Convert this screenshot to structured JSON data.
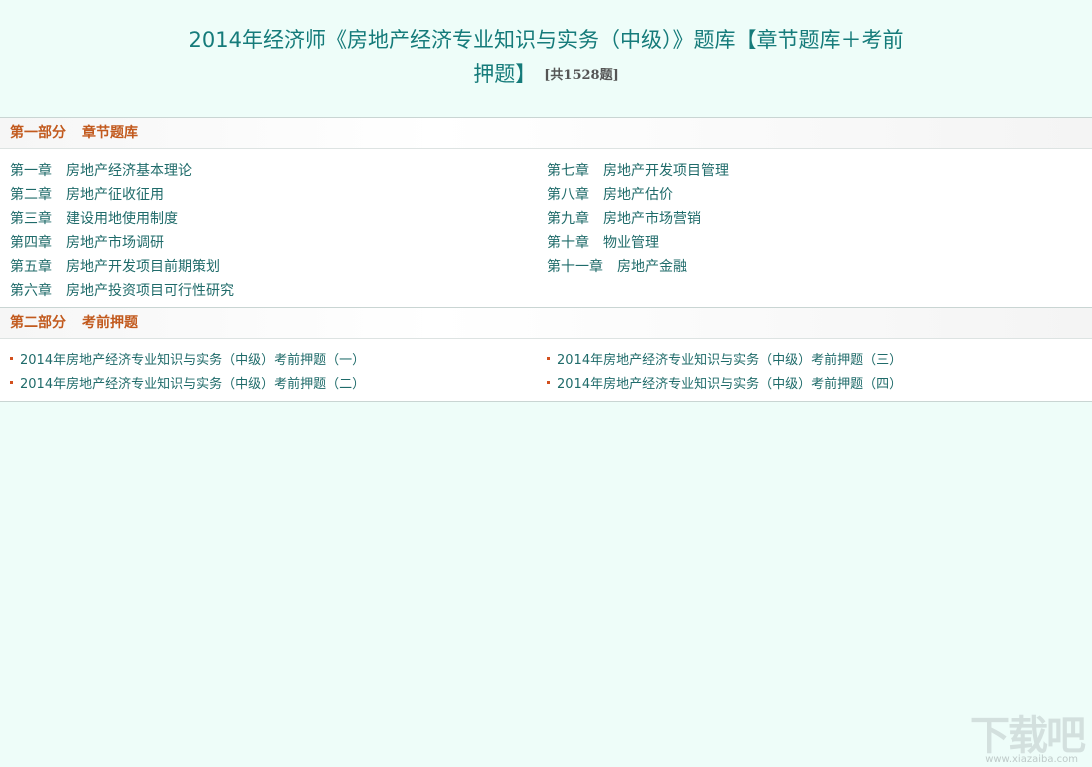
{
  "header": {
    "title_line1": "2014年经济师《房地产经济专业知识与实务（中级）》题库【章节题库＋考前",
    "title_line2": "押题】",
    "count": "[共1528题]"
  },
  "part1": {
    "part": "第一部分",
    "name": "章节题库",
    "chapters": [
      {
        "num": "第一章",
        "title": "房地产经济基本理论"
      },
      {
        "num": "第七章",
        "title": "房地产开发项目管理"
      },
      {
        "num": "第二章",
        "title": "房地产征收征用"
      },
      {
        "num": "第八章",
        "title": "房地产估价"
      },
      {
        "num": "第三章",
        "title": "建设用地使用制度"
      },
      {
        "num": "第九章",
        "title": "房地产市场营销"
      },
      {
        "num": "第四章",
        "title": "房地产市场调研"
      },
      {
        "num": "第十章",
        "title": "物业管理"
      },
      {
        "num": "第五章",
        "title": "房地产开发项目前期策划"
      },
      {
        "num": "第十一章",
        "title": "房地产金融"
      },
      {
        "num": "第六章",
        "title": "房地产投资项目可行性研究"
      }
    ]
  },
  "part2": {
    "part": "第二部分",
    "name": "考前押题",
    "items": [
      "2014年房地产经济专业知识与实务（中级）考前押题（一）",
      "2014年房地产经济专业知识与实务（中级）考前押题（三）",
      "2014年房地产经济专业知识与实务（中级）考前押题（二）",
      "2014年房地产经济专业知识与实务（中级）考前押题（四）"
    ]
  },
  "watermark": {
    "logo": "下载吧",
    "url": "www.xiazaiba.com"
  },
  "colors": {
    "background": "#eefdf9",
    "title": "#157b7a",
    "section_head": "#c25a1e",
    "link": "#1f6b6a",
    "bullet": "#d2501e"
  }
}
